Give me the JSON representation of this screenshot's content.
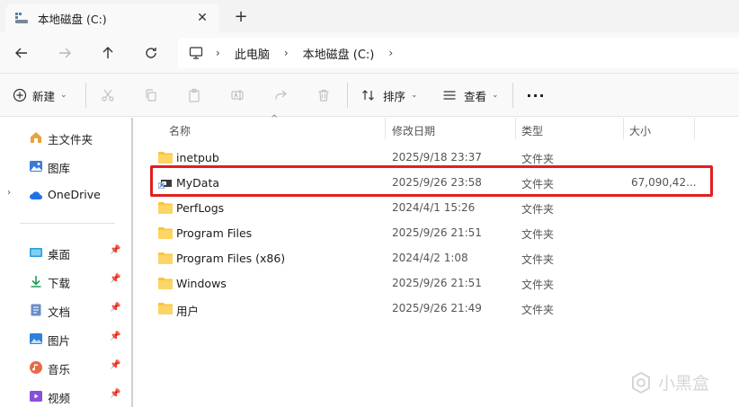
{
  "tab": {
    "title": "本地磁盘 (C:)",
    "close": "✕",
    "new_tab": "+"
  },
  "address": {
    "crumbs": [
      "此电脑",
      "本地磁盘 (C:)"
    ],
    "separator": "›"
  },
  "toolbar": {
    "new_label": "新建",
    "sort_label": "排序",
    "view_label": "查看",
    "more_label": "···"
  },
  "sidebar": {
    "top": [
      {
        "label": "主文件夹",
        "icon": "home-icon"
      },
      {
        "label": "图库",
        "icon": "gallery-icon"
      },
      {
        "label": "OneDrive",
        "icon": "cloud-icon"
      }
    ],
    "pinned": [
      {
        "label": "桌面",
        "icon": "desktop-icon"
      },
      {
        "label": "下载",
        "icon": "download-icon"
      },
      {
        "label": "文档",
        "icon": "document-icon"
      },
      {
        "label": "图片",
        "icon": "picture-icon"
      },
      {
        "label": "音乐",
        "icon": "music-icon"
      },
      {
        "label": "视频",
        "icon": "video-icon"
      }
    ]
  },
  "columns": {
    "name": "名称",
    "modified": "修改日期",
    "type": "类型",
    "size": "大小"
  },
  "files": [
    {
      "name": "inetpub",
      "modified": "2025/9/18 23:37",
      "type": "文件夹",
      "size": "",
      "icon": "folder-icon"
    },
    {
      "name": "MyData",
      "modified": "2025/9/26 23:58",
      "type": "文件夹",
      "size": "67,090,42...",
      "icon": "symlink-folder-icon"
    },
    {
      "name": "PerfLogs",
      "modified": "2024/4/1 15:26",
      "type": "文件夹",
      "size": "",
      "icon": "folder-icon"
    },
    {
      "name": "Program Files",
      "modified": "2025/9/26 21:51",
      "type": "文件夹",
      "size": "",
      "icon": "folder-icon"
    },
    {
      "name": "Program Files (x86)",
      "modified": "2024/4/2 1:08",
      "type": "文件夹",
      "size": "",
      "icon": "folder-icon"
    },
    {
      "name": "Windows",
      "modified": "2025/9/26 21:51",
      "type": "文件夹",
      "size": "",
      "icon": "folder-icon"
    },
    {
      "name": "用户",
      "modified": "2025/9/26 21:49",
      "type": "文件夹",
      "size": "",
      "icon": "folder-icon"
    }
  ],
  "watermark": {
    "text": "小黑盒"
  },
  "colors": {
    "folder": "#f8c53a",
    "accent": "#0067c0",
    "highlight": "#e02020"
  }
}
